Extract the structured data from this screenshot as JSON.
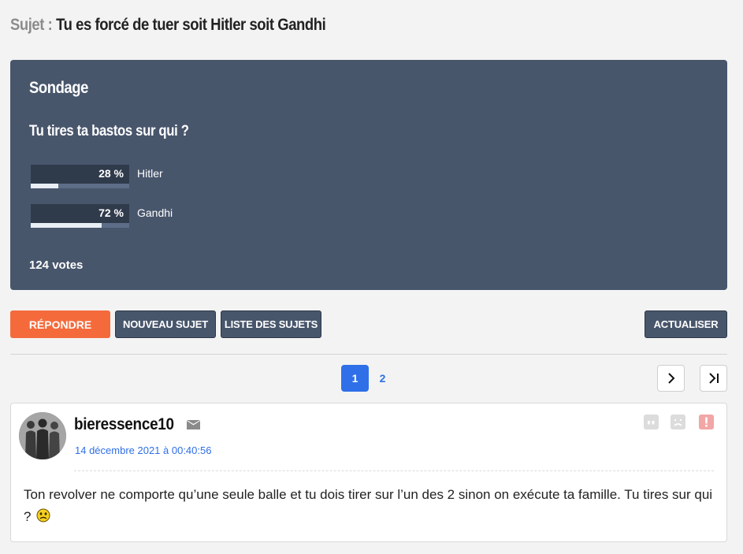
{
  "topic": {
    "prefix": "Sujet :",
    "title": "Tu es forcé de tuer soit Hitler soit Gandhi"
  },
  "poll": {
    "heading": "Sondage",
    "question": "Tu tires ta bastos sur qui ?",
    "options": [
      {
        "label": "Hitler",
        "percent_text": "28 %",
        "percent": 28
      },
      {
        "label": "Gandhi",
        "percent_text": "72 %",
        "percent": 72
      }
    ],
    "votes": "124 votes"
  },
  "actions": {
    "reply": "RÉPONDRE",
    "new_topic": "NOUVEAU SUJET",
    "topic_list": "LISTE DES SUJETS",
    "refresh": "ACTUALISER"
  },
  "pagination": {
    "pages": [
      "1",
      "2"
    ],
    "current": "1",
    "next_icon": "chevron-right-icon",
    "last_icon": "last-page-icon"
  },
  "post": {
    "author": "bieressence10",
    "date": "14 décembre 2021 à 00:40:56",
    "body": "Ton revolver ne comporte qu’une seule balle et tu dois tirer sur l’un des 2 sinon on exécute ta famille. Tu tires sur qui ?",
    "icons": [
      "mail-icon",
      "quote-icon",
      "sad-face-icon",
      "alert-icon",
      "smiley-icon"
    ]
  },
  "colors": {
    "poll_bg": "#48566c",
    "reply": "#f56a3b",
    "accent": "#2f6fe8"
  }
}
